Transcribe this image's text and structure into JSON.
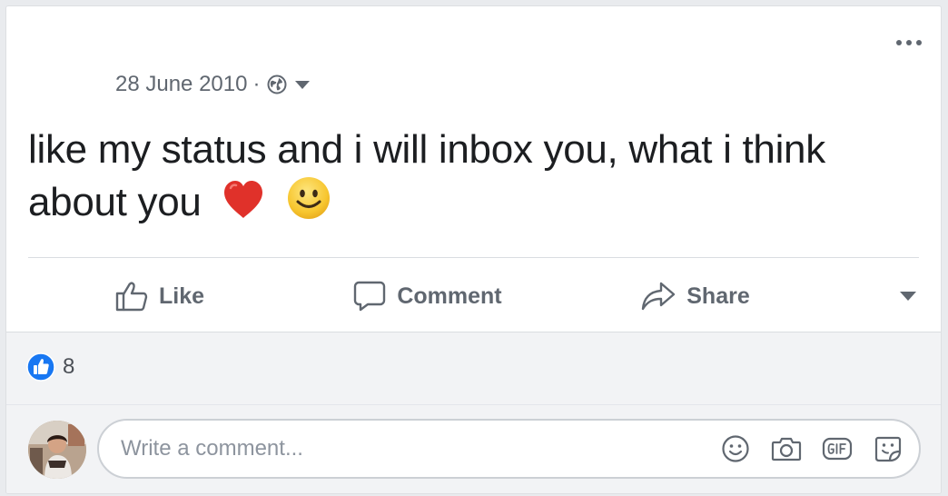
{
  "post": {
    "date": "28 June 2010",
    "separator": "·",
    "audience_icon": "globe-icon",
    "text": "like my status and i will inbox you, what i think about you",
    "emojis": [
      "heart-emoji",
      "smile-emoji"
    ]
  },
  "actions": {
    "like_label": "Like",
    "comment_label": "Comment",
    "share_label": "Share"
  },
  "reactions": {
    "icon": "like-reaction-icon",
    "count": "8"
  },
  "comment_box": {
    "placeholder": "Write a comment...",
    "tools": [
      "emoji-icon",
      "camera-icon",
      "gif-icon",
      "sticker-icon"
    ]
  },
  "colors": {
    "accent_blue": "#1877f2",
    "muted_text": "#606770",
    "heart_red": "#e0312a",
    "smile_yellow": "#f7c62f"
  }
}
